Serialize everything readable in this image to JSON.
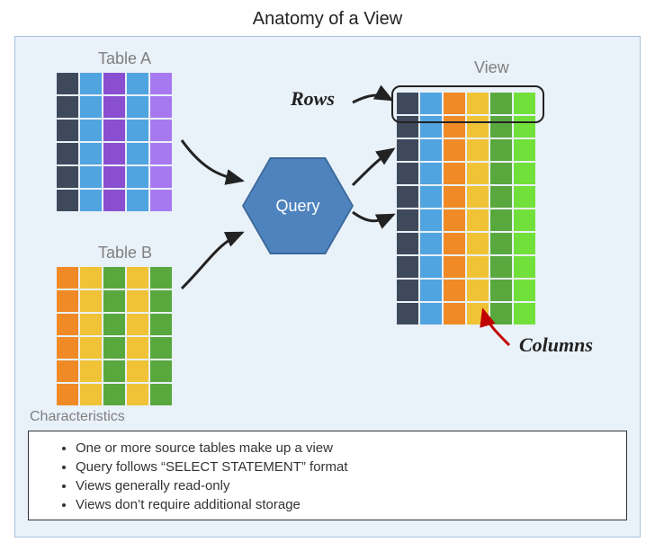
{
  "title": "Anatomy of a View",
  "labels": {
    "tableA": "Table A",
    "tableB": "Table B",
    "view": "View",
    "rows": "Rows",
    "columns": "Columns",
    "query": "Query",
    "characteristics": "Characteristics"
  },
  "characteristics": {
    "c0": "One or more source tables make up a view",
    "c1": "Query follows “SELECT STATEMENT” format",
    "c2": "Views generally read-only",
    "c3": "Views don’t require additional storage"
  },
  "colors": {
    "darkblue": "#3e4a5c",
    "skyblue": "#50a4e0",
    "purple": "#8a4fd0",
    "violet": "#a779f0",
    "orange": "#f08a26",
    "yellow": "#f0c336",
    "green": "#59a83e",
    "lime": "#72e03a",
    "hexfill": "#4e83bd"
  },
  "tableA_cols": [
    "darkblue",
    "skyblue",
    "purple",
    "skyblue",
    "violet"
  ],
  "tableA_rows": 6,
  "tableB_cols": [
    "orange",
    "yellow",
    "green",
    "yellow",
    "green"
  ],
  "tableB_rows": 6,
  "view_cols": [
    "darkblue",
    "skyblue",
    "orange",
    "yellow",
    "green",
    "lime"
  ],
  "view_rows": 10
}
